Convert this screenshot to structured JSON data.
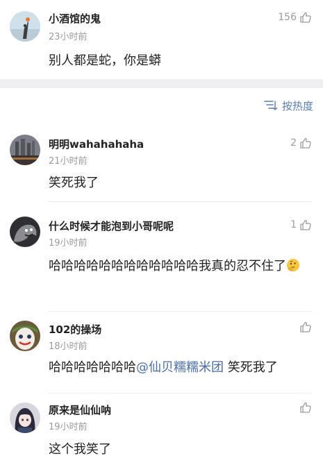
{
  "root_comment": {
    "username": "小酒馆的鬼",
    "time": "23小时前",
    "likes": "156",
    "text": "别人都是蛇，你是蟒"
  },
  "sort": {
    "label": "按热度"
  },
  "replies": [
    {
      "username": "明明wahahahaha",
      "time": "21小时前",
      "likes": "2",
      "text": "笑死我了"
    },
    {
      "username": "什么时候才能泡到小哥呢呢",
      "time": "19小时前",
      "likes": "1",
      "text": "哈哈哈哈哈哈哈哈哈哈哈哈我真的忍不住了",
      "emoji": "thinking-face-emoji"
    },
    {
      "username": "102的操场",
      "time": "18小时前",
      "likes": "",
      "text_before": "哈哈哈哈哈哈哈",
      "mention": "@仙贝糯糯米团",
      "text_after": " 笑死我了"
    },
    {
      "username": "原来是仙仙呐",
      "time": "19小时前",
      "likes": "",
      "text": "这个我笑了"
    }
  ],
  "colors": {
    "accent": "#5b7cae",
    "mention": "#4c6ea5",
    "muted": "#9b9b9b",
    "divider_band": "#efeff1"
  }
}
